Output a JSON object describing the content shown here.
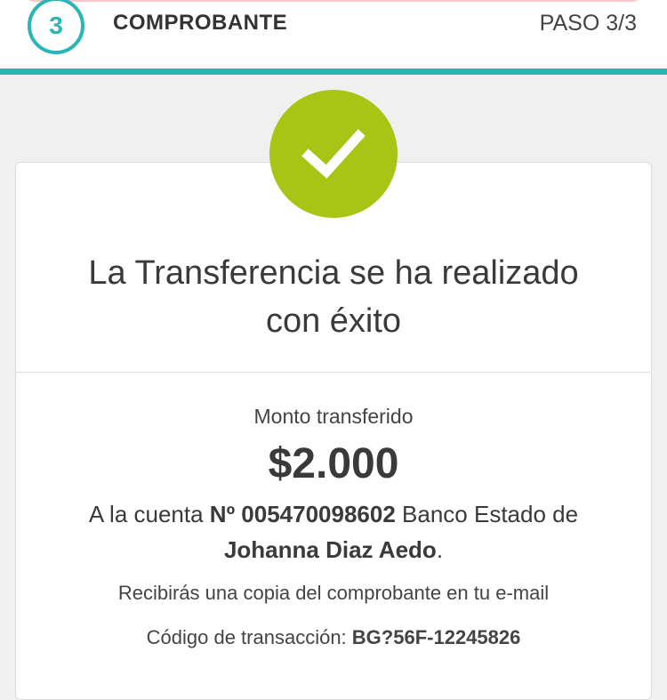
{
  "header": {
    "step_number": "3",
    "step_title": "COMPROBANTE",
    "step_counter": "PASO 3/3"
  },
  "result": {
    "icon": "check-icon",
    "headline_line1": "La Transferencia se ha realizado",
    "headline_line2": "con éxito"
  },
  "details": {
    "amount_label": "Monto transferido",
    "amount": "$2.000",
    "account_prefix": "A la cuenta",
    "account_number": "Nº 005470098602",
    "bank_text": "Banco Estado de",
    "recipient": "Johanna Diaz Aedo",
    "recipient_suffix": ".",
    "email_note": "Recibirás una copia del comprobante en tu e-mail",
    "tx_label": "Código de transacción:",
    "tx_code": "BG?56F-12245826"
  },
  "colors": {
    "accent": "#2bb5b5",
    "success": "#a8c414"
  }
}
